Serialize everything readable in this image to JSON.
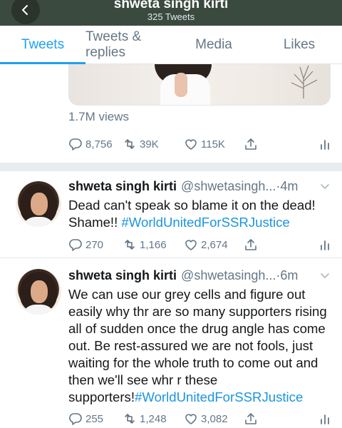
{
  "header": {
    "title": "shweta singh kirti",
    "subtitle": "325 Tweets"
  },
  "tabs": [
    {
      "label": "Tweets",
      "active": true
    },
    {
      "label": "Tweets & replies",
      "active": false
    },
    {
      "label": "Media",
      "active": false
    },
    {
      "label": "Likes",
      "active": false
    }
  ],
  "top_tweet": {
    "views": "1.7M views",
    "replies": "8,756",
    "retweets": "39K",
    "likes": "115K"
  },
  "tweets": [
    {
      "name": "shweta singh kirti",
      "handle": "@shwetasingh...",
      "time": "·4m",
      "text": "Dead can't speak so blame it on the dead! Shame!! ",
      "hashtag": "#WorldUnitedForSSRJustice",
      "replies": "270",
      "retweets": "1,166",
      "likes": "2,674"
    },
    {
      "name": "shweta singh kirti",
      "handle": "@shwetasingh...",
      "time": "·6m",
      "text": "We can use our grey cells and figure out easily why thr are so many supporters rising all of sudden once the drug angle has come out. Be rest-assured we are not fools, just waiting for the whole truth to come out and then we'll see whr r these supporters!",
      "hashtag": "#WorldUnitedForSSRJustice",
      "replies": "255",
      "retweets": "1,248",
      "likes": "3,082"
    }
  ],
  "colors": {
    "accent": "#1da1f2",
    "hashtag": "#1b95e0",
    "secondary_text": "#657786",
    "header_bg": "#3b4a3f"
  },
  "icons": [
    "back-arrow-icon",
    "reply-icon",
    "retweet-icon",
    "like-icon",
    "share-icon",
    "analytics-icon",
    "chevron-down-icon"
  ]
}
